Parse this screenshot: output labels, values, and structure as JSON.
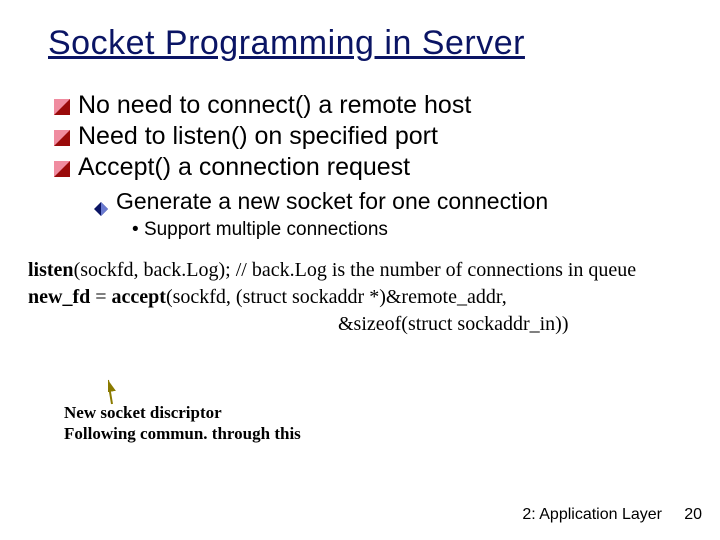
{
  "title": "Socket Programming in Server",
  "bullets": {
    "b1a": "No need to connect() a remote host",
    "b1b": "Need to listen() on specified port",
    "b1c": "Accept() a connection request",
    "b2a": "Generate a new socket for one connection",
    "b3a": "Support multiple connections"
  },
  "code": {
    "line1_bold": "listen",
    "line1_rest": "(sockfd, back.Log);   // back.Log is the number of connections in queue",
    "line2_bold1": "new_fd",
    "line2_mid": " = ",
    "line2_bold2": "accept",
    "line2_rest": "(sockfd, (struct sockaddr *)&remote_addr,",
    "line3": "&sizeof(struct sockaddr_in))"
  },
  "annotation": {
    "l1": "New socket discriptor",
    "l2": "Following commun. through this"
  },
  "footer": "2: Application Layer",
  "page": "20"
}
